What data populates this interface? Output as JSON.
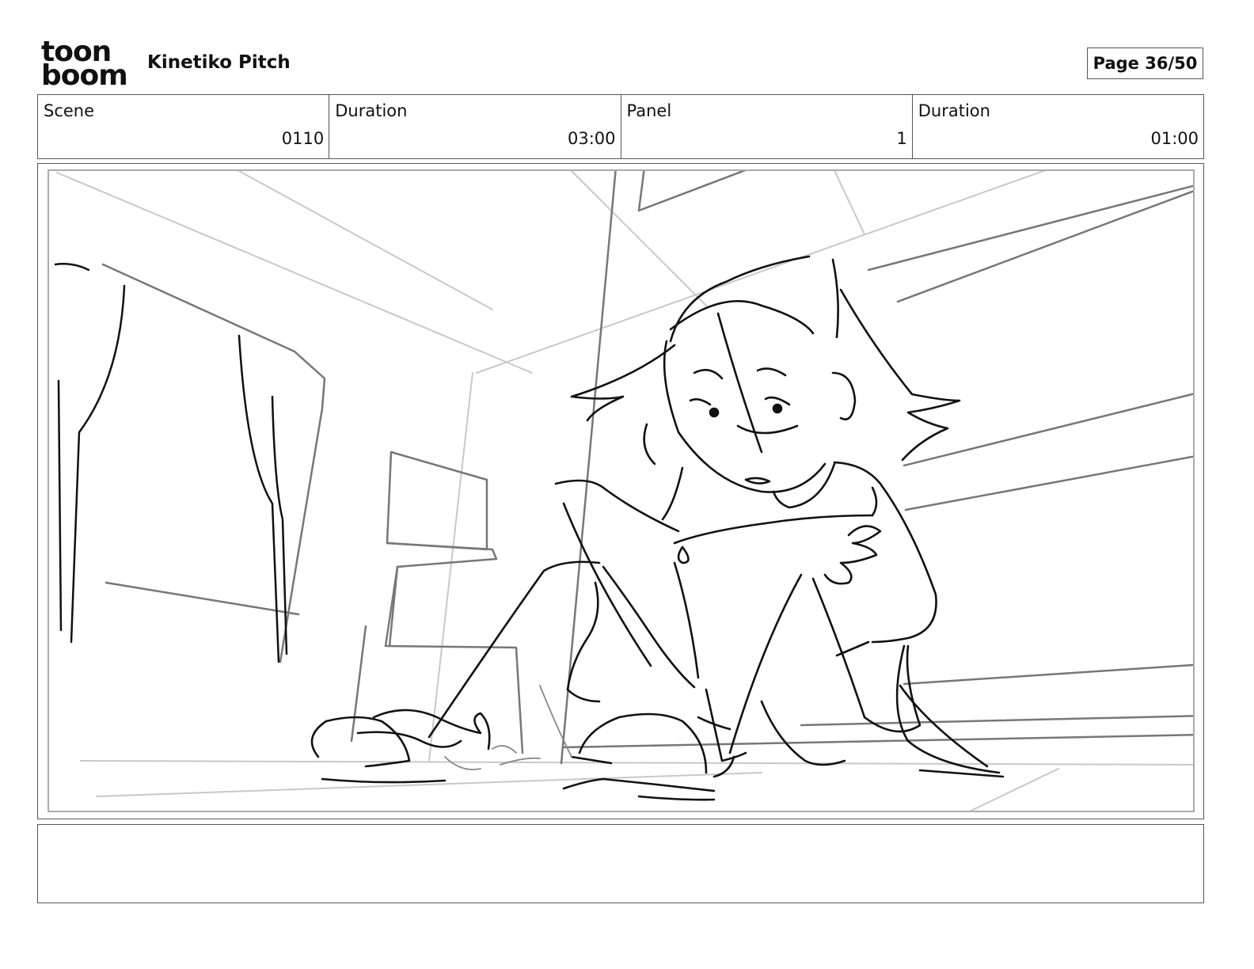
{
  "header": {
    "logo": {
      "line1": "toon",
      "line2": "boom"
    },
    "project_title": "Kinetiko Pitch",
    "page_indicator": "Page 36/50"
  },
  "info": {
    "scene_label": "Scene",
    "scene_value": "0110",
    "scene_duration_label": "Duration",
    "scene_duration_value": "03:00",
    "panel_label": "Panel",
    "panel_value": "1",
    "panel_duration_label": "Duration",
    "panel_duration_value": "01:00"
  },
  "notes": {
    "text": ""
  },
  "colors": {
    "border": "#555555",
    "sketch": "#111111",
    "guide": "#bbbbbb"
  },
  "icons": [
    "toon-boom-logo"
  ]
}
